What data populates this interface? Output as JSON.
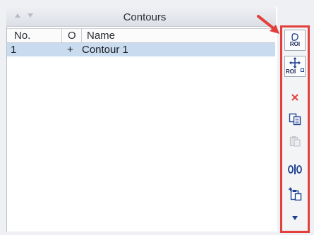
{
  "panel": {
    "title": "Contours"
  },
  "table": {
    "headers": {
      "no": "No.",
      "o": "O",
      "name": "Name"
    },
    "rows": [
      {
        "no": "1",
        "o": "+",
        "name": "Contour 1"
      }
    ]
  },
  "toolbar": {
    "buttons": [
      {
        "icon": "draw-roi-icon",
        "label": "ROI"
      },
      {
        "icon": "move-roi-icon",
        "label": "ROI"
      },
      {
        "icon": "delete-icon",
        "label": ""
      },
      {
        "icon": "copy-icon",
        "label": ""
      },
      {
        "icon": "paste-icon",
        "label": ""
      },
      {
        "icon": "split-icon",
        "label": ""
      },
      {
        "icon": "add-copy-icon",
        "label": ""
      },
      {
        "icon": "more-icon",
        "label": ""
      }
    ]
  },
  "colors": {
    "accent_red": "#e2403c",
    "selected_row": "#c9dbef",
    "icon_blue": "#1e3f8f"
  }
}
